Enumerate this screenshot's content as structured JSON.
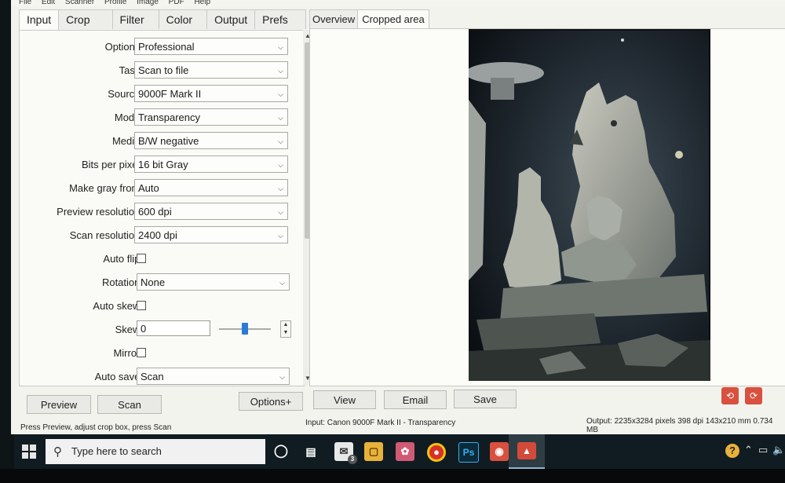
{
  "menu": [
    "File",
    "Edit",
    "Scanner",
    "Profile",
    "Image",
    "PDF",
    "Help"
  ],
  "left_tabs": [
    "Input",
    "Crop",
    "Filter",
    "Color",
    "Output",
    "Prefs"
  ],
  "right_tabs": [
    "Overview",
    "Cropped area"
  ],
  "form": {
    "options": {
      "label": "Options:",
      "value": "Professional"
    },
    "task": {
      "label": "Task:",
      "value": "Scan to file"
    },
    "source": {
      "label": "Source:",
      "value": "9000F Mark II"
    },
    "mode": {
      "label": "Mode:",
      "value": "Transparency"
    },
    "media": {
      "label": "Media:",
      "value": "B/W negative"
    },
    "bits": {
      "label": "Bits per pixel:",
      "value": "16 bit Gray"
    },
    "gray": {
      "label": "Make gray from:",
      "value": "Auto"
    },
    "preview_res": {
      "label": "Preview resolution:",
      "value": "600 dpi"
    },
    "scan_res": {
      "label": "Scan resolution:",
      "value": "2400 dpi"
    },
    "auto_flip": {
      "label": "Auto flip:"
    },
    "rotation": {
      "label": "Rotation:",
      "value": "None"
    },
    "auto_skew": {
      "label": "Auto skew:"
    },
    "skew": {
      "label": "Skew:",
      "value": "0"
    },
    "mirror": {
      "label": "Mirror:"
    },
    "auto_save": {
      "label": "Auto save:",
      "value": "Scan"
    }
  },
  "buttons": {
    "preview": "Preview",
    "scan": "Scan",
    "options_plus": "Options+",
    "view": "View",
    "email": "Email",
    "save": "Save"
  },
  "status": {
    "left": "Press Preview, adjust crop box, press Scan",
    "input": "Input: Canon 9000F Mark II - Transparency",
    "output": "Output: 2235x3284 pixels 398 dpi 143x210 mm 0.734 MB"
  },
  "taskbar": {
    "search_placeholder": "Type here to search",
    "mail_badge": "3"
  },
  "icons": {
    "start": "windows-logo-icon",
    "search": "magnifier-icon",
    "cortana": "circle-icon",
    "taskview": "task-view-icon",
    "chrome": "chrome-icon",
    "photoshop": "photoshop-icon"
  },
  "colors": {
    "slider_accent": "#2a7bd5",
    "chrome_red": "#d93025",
    "photoshop_bg": "#0d2a3a"
  }
}
